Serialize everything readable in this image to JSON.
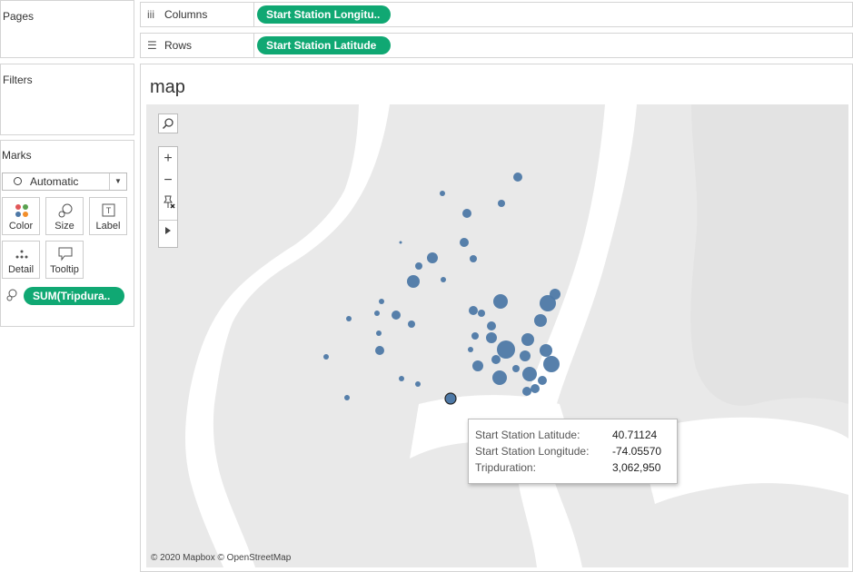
{
  "panels": {
    "pages_title": "Pages",
    "filters_title": "Filters",
    "marks_title": "Marks"
  },
  "shelves": {
    "columns_label": "Columns",
    "columns_pill": "Start Station Longitu..",
    "rows_label": "Rows",
    "rows_pill": "Start Station Latitude"
  },
  "marks": {
    "mark_type": "Automatic",
    "cards": {
      "color": "Color",
      "size": "Size",
      "label": "Label",
      "detail": "Detail",
      "tooltip": "Tooltip"
    },
    "size_pill": "SUM(Tripdura.."
  },
  "view": {
    "title": "map",
    "attribution": "© 2020 Mapbox © OpenStreetMap",
    "map_tools": {
      "search_icon": "search-icon",
      "zoom_in": "+",
      "zoom_out": "−",
      "pin_icon": "pin-icon",
      "expand_icon": "play-icon"
    }
  },
  "tooltip": {
    "rows": [
      {
        "key": "Start Station Latitude:",
        "value": "40.71124"
      },
      {
        "key": "Start Station Longitude:",
        "value": "-74.05570"
      },
      {
        "key": "Tripduration:",
        "value": "3,062,950"
      }
    ]
  },
  "colors": {
    "pill": "#10a873",
    "mark": "#4e79a7",
    "map_land": "#e9e9e9",
    "map_water": "#ffffff"
  }
}
